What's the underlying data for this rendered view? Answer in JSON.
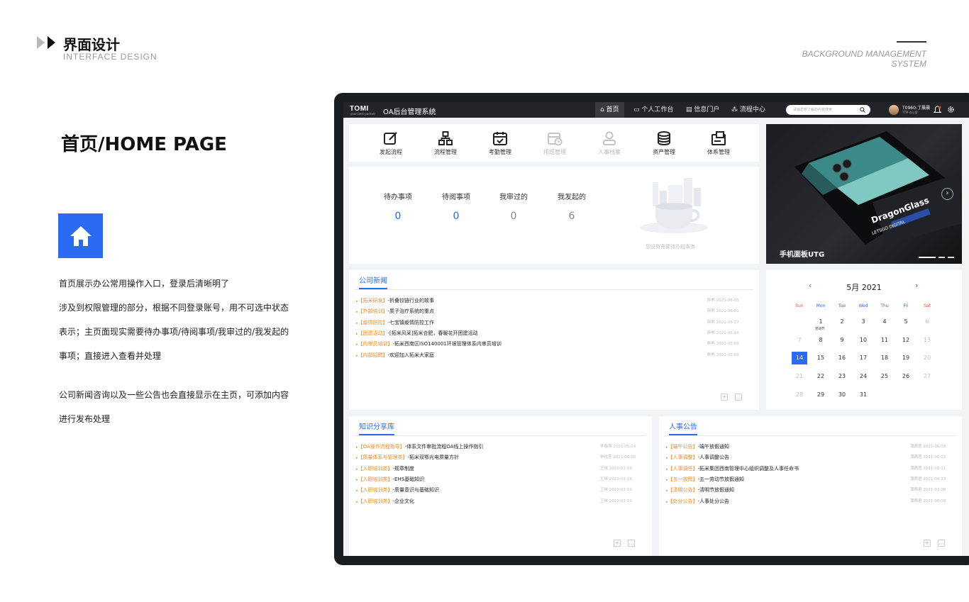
{
  "header": {
    "title": "界面设计",
    "subtitle": "INTERFACE DESIGN",
    "right_text": "BACKGROUND MANAGEMENT SYSTEM"
  },
  "page_title": "首页/HOME PAGE",
  "description": [
    "首页展示办公常用操作入口，登录后清晰明了",
    "涉及到权限管理的部分，根据不同登录账号，用不可选中状态",
    "表示；主页面现实需要待办事项/待阅事项/我审过的/我发起的",
    "事项；直接进入查看并处理",
    "公司新闻咨询以及一些公告也会直接显示在主页，可添加内容",
    "进行发布处理"
  ],
  "app": {
    "logo": "TOMI",
    "logo_tag": "your best partner",
    "name": "OA后台管理系统",
    "nav": [
      "首页",
      "个人工作台",
      "信息门户",
      "流程中心"
    ],
    "search_placeholder": "请输您想了解的内容搜索",
    "user_name": "T0960-丁晨晨",
    "user_dept": "TTM-办公室",
    "accent": "#2b6bf3",
    "tag_color": "#f08a24"
  },
  "quick_actions": [
    {
      "label": "发起流程",
      "icon": "edit-icon",
      "enabled": true
    },
    {
      "label": "流程管理",
      "icon": "flow-icon",
      "enabled": true
    },
    {
      "label": "考勤管理",
      "icon": "calendar-check-icon",
      "enabled": true
    },
    {
      "label": "排班管理",
      "icon": "schedule-icon",
      "enabled": false
    },
    {
      "label": "人事档案",
      "icon": "person-icon",
      "enabled": false
    },
    {
      "label": "资产管理",
      "icon": "database-icon",
      "enabled": true
    },
    {
      "label": "体系管理",
      "icon": "system-icon",
      "enabled": true
    }
  ],
  "stats": [
    {
      "label": "待办事项",
      "value": "0"
    },
    {
      "label": "待阅事项",
      "value": "0"
    },
    {
      "label": "我审过的",
      "value": "0"
    },
    {
      "label": "我发起的",
      "value": "6"
    }
  ],
  "empty_text": "您没有需要待办的事务",
  "banner": {
    "caption": "手机面板UTG",
    "product_text": "DragonGlass",
    "product_sub": "LETSGO DIGITAL"
  },
  "news": {
    "title": "公司新闻",
    "items": [
      {
        "tag": "【拓米研发】",
        "text": "-折叠铰链行业的故事",
        "meta": "胖熊 2021-06-05"
      },
      {
        "tag": "【外部培训】",
        "text": "-质子治疗系统的重点",
        "meta": "胖熊 2021-06-01"
      },
      {
        "tag": "【疫情防控】",
        "text": "-七宝镇疫情防控工作",
        "meta": "胖熊 2021-05-27"
      },
      {
        "tag": "【团建活动】",
        "text": "-[拓米风采]拓米合肥，春暖花开团建活动",
        "meta": "胖熊 2021-05-16"
      },
      {
        "tag": "【内审员培训】",
        "text": "-拓米西南区ISO140001环境管理体系内审员培训",
        "meta": "胖熊 2021-05-09"
      },
      {
        "tag": "【内部招聘】",
        "text": "-欢迎加入拓米大家庭",
        "meta": "胖熊 2021-05-09"
      }
    ]
  },
  "calendar": {
    "month_label": "5月 2021",
    "weekdays": [
      "Sun",
      "Mon",
      "Tue",
      "Wed",
      "Thu",
      "Fri",
      "Sat"
    ],
    "note": "劳动节",
    "selected": "14",
    "rows": [
      [
        "",
        "1",
        "2",
        "3",
        "4",
        "5",
        "6"
      ],
      [
        "7",
        "8",
        "9",
        "10",
        "11",
        "12",
        "13"
      ],
      [
        "14",
        "15",
        "16",
        "17",
        "18",
        "19",
        "20"
      ],
      [
        "21",
        "22",
        "23",
        "24",
        "25",
        "26",
        "27"
      ],
      [
        "28",
        "29",
        "30",
        "31",
        "",
        "",
        ""
      ]
    ]
  },
  "knowledge": {
    "title": "知识分享库",
    "items": [
      {
        "tag": "【OA操作流程指导】",
        "text": "-体系文件审批流程OA线上操作指引",
        "meta": "李春燕 2021-05-14"
      },
      {
        "tag": "【质量体系与管理类】",
        "text": "-拓米双鄂光电质量方针",
        "meta": "申桂芝 2021-04-20"
      },
      {
        "tag": "【入职培训类】",
        "text": "-规章制度",
        "meta": "王咪 2021-03-19"
      },
      {
        "tag": "【入职培训类】",
        "text": "-EHS基础知识",
        "meta": "王咪 2021-03-19"
      },
      {
        "tag": "【入职培训类】",
        "text": "-质量意识与基础知识",
        "meta": "王咪 2021-03-19"
      },
      {
        "tag": "【入职培训类】",
        "text": "-企业文化",
        "meta": "王咪 2021-03-19"
      }
    ]
  },
  "hr_notices": {
    "title": "人事公告",
    "items": [
      {
        "tag": "【端午公告】",
        "text": "-端午放假通知",
        "meta": "蒲茜君 2021-06-09"
      },
      {
        "tag": "【人事调整】",
        "text": "-人事调整公告",
        "meta": "蒲茜君 2021-06-03"
      },
      {
        "tag": "【人事调任】",
        "text": "-拓米集团西南管理中心组织调整及人事任命书",
        "meta": "蒲茜君 2021-05-11"
      },
      {
        "tag": "【五一放假】",
        "text": "-五一劳动节放假通知",
        "meta": "蒲茜君 2021-04-23"
      },
      {
        "tag": "【清明公告】",
        "text": "-清明节放假通知",
        "meta": "蒲茜君 2021-03-26"
      },
      {
        "tag": "【处分公告】",
        "text": "-人事处分公告",
        "meta": "蒲茜君 2021-06-09"
      }
    ]
  }
}
